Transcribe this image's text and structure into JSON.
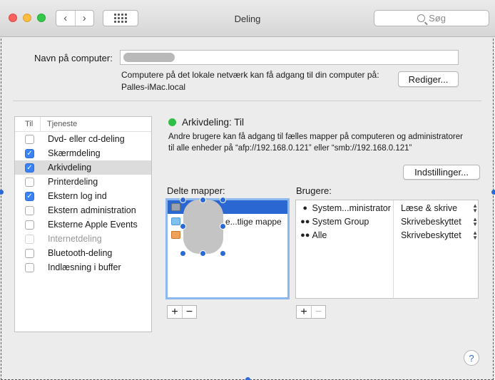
{
  "window": {
    "title": "Deling"
  },
  "toolbar": {
    "back": "‹",
    "forward": "›",
    "search_placeholder": "Søg"
  },
  "computer": {
    "name_label": "Navn på computer:",
    "info_line1": "Computere på det lokale netværk kan få adgang til din computer på:",
    "info_line2": "Palles-iMac.local",
    "edit_button": "Rediger..."
  },
  "services": {
    "col_on": "Til",
    "col_service": "Tjeneste",
    "items": [
      {
        "label": "Dvd- eller cd-deling",
        "checked": false,
        "enabled": true
      },
      {
        "label": "Skærmdeling",
        "checked": true,
        "enabled": true
      },
      {
        "label": "Arkivdeling",
        "checked": true,
        "enabled": true,
        "selected": true
      },
      {
        "label": "Printerdeling",
        "checked": false,
        "enabled": true
      },
      {
        "label": "Ekstern log ind",
        "checked": true,
        "enabled": true
      },
      {
        "label": "Ekstern administration",
        "checked": false,
        "enabled": true
      },
      {
        "label": "Eksterne Apple Events",
        "checked": false,
        "enabled": true
      },
      {
        "label": "Internetdeling",
        "checked": false,
        "enabled": false
      },
      {
        "label": "Bluetooth-deling",
        "checked": false,
        "enabled": true
      },
      {
        "label": "Indlæsning i buffer",
        "checked": false,
        "enabled": true
      }
    ]
  },
  "detail": {
    "status_color": "#2fbe46",
    "status_title": "Arkivdeling: Til",
    "desc_line1": "Andre brugere kan få adgang til fælles mapper på computeren og administratorer",
    "desc_line2": "til alle enheder på “afp://192.168.0.121” eller “smb://192.168.0.121”",
    "options_button": "Indstillinger...",
    "shared_folders_label": "Delte mapper:",
    "users_label": "Brugere:",
    "folders": [
      {
        "label": "",
        "icon": "hard-drive-icon"
      },
      {
        "label": "e...tlige mappe",
        "icon": "public-folder-icon"
      },
      {
        "label": "",
        "icon": "home-folder-icon"
      }
    ],
    "users": [
      {
        "name": "System...ministrator",
        "permission": "Læse & skrive",
        "icon": "user-icon"
      },
      {
        "name": "System Group",
        "permission": "Skrivebeskyttet",
        "icon": "group-icon"
      },
      {
        "name": "Alle",
        "permission": "Skrivebeskyttet",
        "icon": "everyone-icon"
      }
    ],
    "add": "+",
    "remove": "−"
  },
  "help": "?"
}
